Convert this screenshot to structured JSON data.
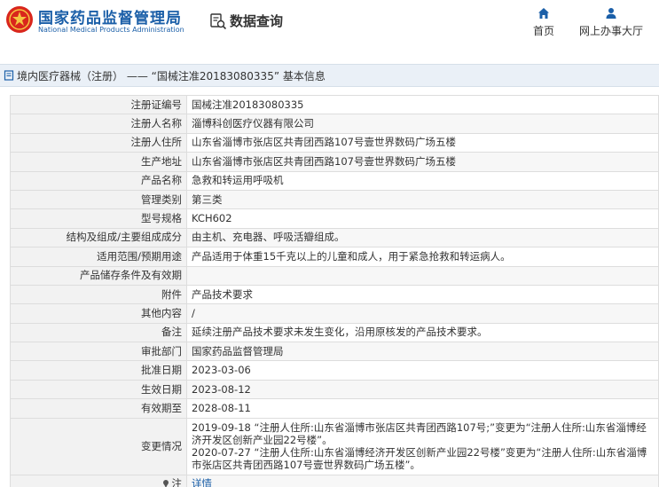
{
  "header": {
    "logo_cn": "国家药品监督管理局",
    "logo_en": "National Medical Products Administration",
    "data_query": "数据查询",
    "nav": [
      {
        "label": "首页",
        "icon": "home-icon"
      },
      {
        "label": "网上办事大厅",
        "icon": "user-icon"
      }
    ]
  },
  "title": "境内医疗器械（注册） —— “国械注准20183080335” 基本信息",
  "rows": [
    {
      "label": "注册证编号",
      "value": "国械注准20183080335"
    },
    {
      "label": "注册人名称",
      "value": "淄博科创医疗仪器有限公司"
    },
    {
      "label": "注册人住所",
      "value": "山东省淄博市张店区共青团西路107号壹世界数码广场五楼"
    },
    {
      "label": "生产地址",
      "value": "山东省淄博市张店区共青团西路107号壹世界数码广场五楼"
    },
    {
      "label": "产品名称",
      "value": "急救和转运用呼吸机"
    },
    {
      "label": "管理类别",
      "value": "第三类"
    },
    {
      "label": "型号规格",
      "value": "KCH602"
    },
    {
      "label": "结构及组成/主要组成成分",
      "value": "由主机、充电器、呼吸活瓣组成。"
    },
    {
      "label": "适用范围/预期用途",
      "value": "产品适用于体重15千克以上的儿童和成人，用于紧急抢救和转运病人。"
    },
    {
      "label": "产品储存条件及有效期",
      "value": ""
    },
    {
      "label": "附件",
      "value": "产品技术要求"
    },
    {
      "label": "其他内容",
      "value": "/"
    },
    {
      "label": "备注",
      "value": "延续注册产品技术要求未发生变化，沿用原核发的产品技术要求。"
    },
    {
      "label": "审批部门",
      "value": "国家药品监督管理局"
    },
    {
      "label": "批准日期",
      "value": "2023-03-06"
    },
    {
      "label": "生效日期",
      "value": "2023-08-12"
    },
    {
      "label": "有效期至",
      "value": "2028-08-11"
    }
  ],
  "changes": {
    "label": "变更情况",
    "line1": "2019-09-18  “注册人住所:山东省淄博市张店区共青团西路107号;”变更为“注册人住所:山东省淄博经济开发区创新产业园22号楼”。",
    "line2": "2020-07-27  “注册人住所:山东省淄博经济开发区创新产业园22号楼”变更为“注册人住所:山东省淄博市张店区共青团西路107号壹世界数码广场五楼”。"
  },
  "note": {
    "label": "注",
    "link": "详情"
  },
  "colors": {
    "brand_blue": "#1b5fa8",
    "logo_red": "#d9261c",
    "title_bar_bg": "#eaf0f7"
  }
}
